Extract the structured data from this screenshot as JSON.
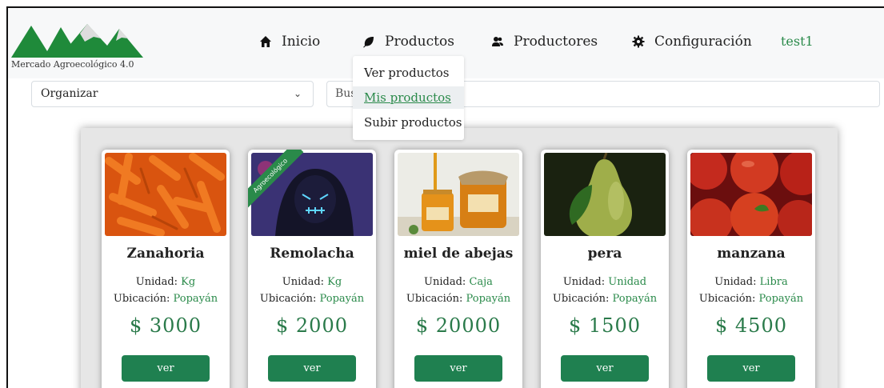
{
  "brand": {
    "logo_text": "Mercado Agroecológico 4.0"
  },
  "nav": {
    "items": [
      {
        "label": "Inicio",
        "icon": "home-icon"
      },
      {
        "label": "Productos",
        "icon": "leaf-icon"
      },
      {
        "label": "Productores",
        "icon": "users-icon"
      },
      {
        "label": "Configuración",
        "icon": "gear-icon"
      }
    ],
    "user": "test1"
  },
  "dropdown": {
    "items": [
      "Ver productos",
      "Mis productos",
      "Subir productos"
    ],
    "active_index": 1
  },
  "filters": {
    "sort_label": "Organizar",
    "search_placeholder": "Bus"
  },
  "products": [
    {
      "name": "Zanahoria",
      "unit_label": "Unidad:",
      "unit": "Kg",
      "location_label": "Ubicación:",
      "location": "Popayán",
      "price": "$ 3000",
      "button": "ver",
      "image": "carrots"
    },
    {
      "name": "Remolacha",
      "unit_label": "Unidad:",
      "unit": "Kg",
      "location_label": "Ubicación:",
      "location": "Popayán",
      "price": "$ 2000",
      "button": "ver",
      "image": "masked-figure",
      "badge": "Agroecológico"
    },
    {
      "name": "miel de abejas",
      "unit_label": "Unidad:",
      "unit": "Caja",
      "location_label": "Ubicación:",
      "location": "Popayán",
      "price": "$ 20000",
      "button": "ver",
      "image": "honey-jars"
    },
    {
      "name": "pera",
      "unit_label": "Unidad:",
      "unit": "Unidad",
      "location_label": "Ubicación:",
      "location": "Popayán",
      "price": "$ 1500",
      "button": "ver",
      "image": "pear"
    },
    {
      "name": "manzana",
      "unit_label": "Unidad:",
      "unit": "Libra",
      "location_label": "Ubicación:",
      "location": "Popayán",
      "price": "$ 4500",
      "button": "ver",
      "image": "apples"
    }
  ],
  "colors": {
    "accent": "#2a8a4a",
    "button": "#1f8050",
    "navbar_bg": "#f7f8f9"
  }
}
